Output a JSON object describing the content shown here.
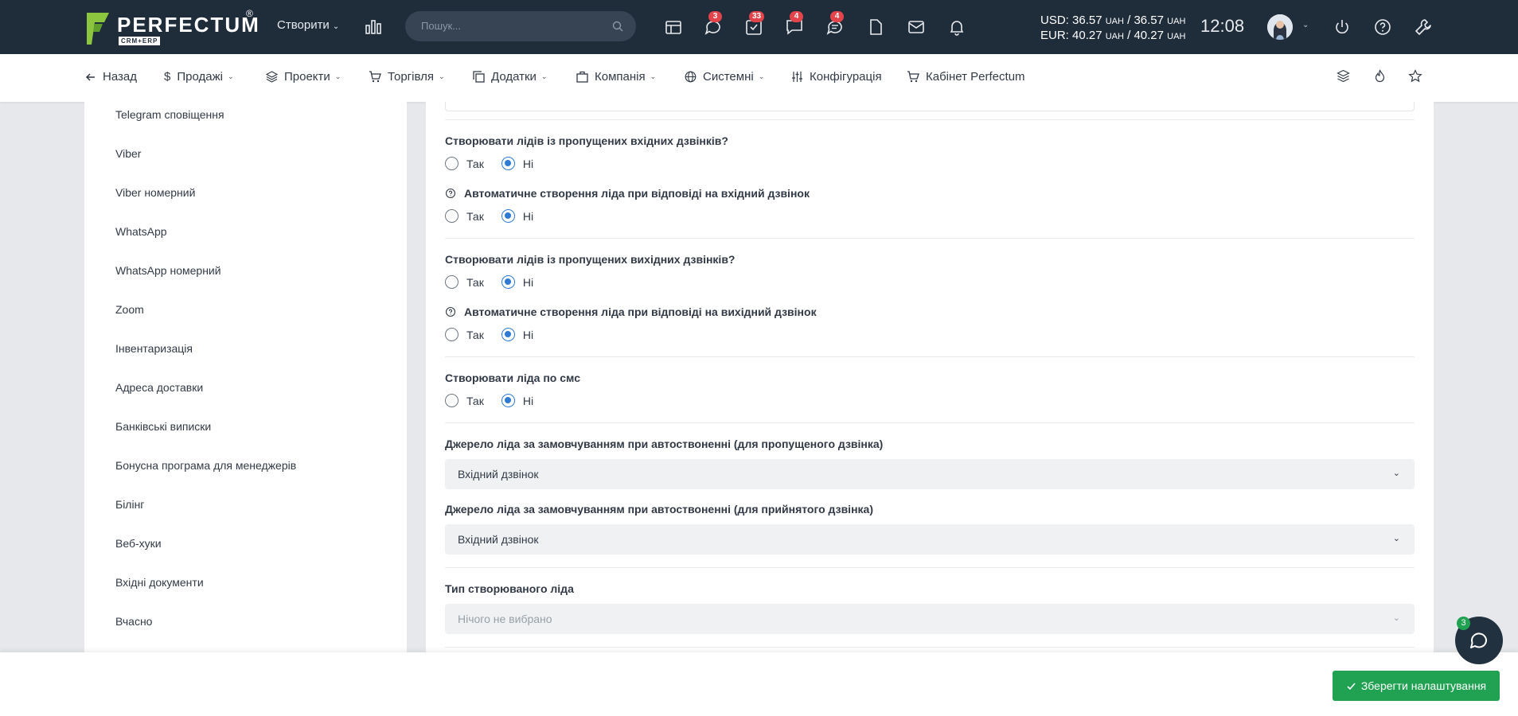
{
  "header": {
    "logo_text": "PERFECTUM",
    "logo_sub": "CRM+ERP",
    "logo_reg": "®",
    "create_label": "Створити",
    "search_placeholder": "Пошук...",
    "badges": {
      "chat": "3",
      "tasks": "33",
      "messages": "4",
      "comments": "4"
    },
    "currency_usd": "USD: 36.57",
    "currency_usd_tail": "/ 36.57",
    "currency_eur": "EUR: 40.27",
    "currency_eur_tail": "/ 40.27",
    "currency_unit": "UAH",
    "time": "12:08"
  },
  "nav": {
    "back": "Назад",
    "sales": "Продажі",
    "projects": "Проекти",
    "trade": "Торгівля",
    "addons": "Додатки",
    "company": "Компанія",
    "system": "Системні",
    "config": "Конфігурація",
    "cabinet": "Кабінет Perfectum"
  },
  "sidebar": {
    "items": [
      "Telegram сповіщення",
      "Viber",
      "Viber номерний",
      "WhatsApp",
      "WhatsApp номерний",
      "Zoom",
      "Інвентаризація",
      "Адреса доставки",
      "Банківські виписки",
      "Бонусна програма для менеджерів",
      "Білінг",
      "Веб-хуки",
      "Вхідні документи",
      "Вчасно"
    ]
  },
  "form": {
    "yes": "Так",
    "no": "Ні",
    "q1": "Створювати лідів із пропущених вхідних дзвінків?",
    "q2": "Автоматичне створення ліда при відповіді на вхідний дзвінок",
    "q3": "Створювати лідів із пропущених вихідних дзвінків?",
    "q4": "Автоматичне створення ліда при відповіді на вихідний дзвінок",
    "q5": "Створювати ліда по смс",
    "q6": "Джерело ліда за замовчуванням при автоствоненні (для пропущеного дзвінка)",
    "q6_value": "Вхідний дзвінок",
    "q7": "Джерело ліда за замовчуванням при автоствоненні (для прийнятого дзвінка)",
    "q7_value": "Вхідний дзвінок",
    "q8": "Тип створюваного ліда",
    "q8_value": "Нічого не вибрано"
  },
  "footer": {
    "save_label": "Зберегти налаштування",
    "chat_badge": "3"
  },
  "colors": {
    "topbar": "#1f2c3a",
    "radio_on": "#2f7ad3",
    "save": "#21a252",
    "badge": "#e3444b"
  }
}
